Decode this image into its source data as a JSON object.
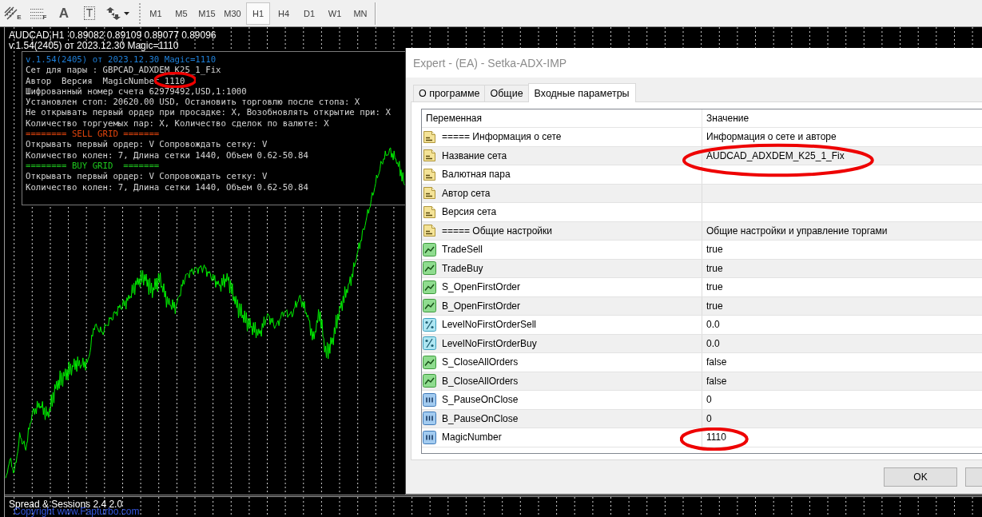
{
  "toolbar": {
    "tools": [
      {
        "kind": "channel",
        "glyph": "E",
        "dropdown": false
      },
      {
        "kind": "levels",
        "glyph": "F",
        "dropdown": false
      },
      {
        "kind": "text",
        "glyph": "A",
        "dropdown": false
      },
      {
        "kind": "label",
        "glyph": "T",
        "dropdown": false
      },
      {
        "kind": "arrows",
        "dropdown": true
      }
    ],
    "timeframes": [
      {
        "label": "M1",
        "selected": false
      },
      {
        "label": "M5",
        "selected": false
      },
      {
        "label": "M15",
        "selected": false
      },
      {
        "label": "M30",
        "selected": false
      },
      {
        "label": "H1",
        "selected": true
      },
      {
        "label": "H4",
        "selected": false
      },
      {
        "label": "D1",
        "selected": false
      },
      {
        "label": "W1",
        "selected": false
      },
      {
        "label": "MN",
        "selected": false
      }
    ]
  },
  "chart": {
    "header": [
      "AUDCAD,H1  0.89082 0.89109 0.89077 0.89096",
      "v.1.54(2405) от 2023.12.30 Magic=1110"
    ],
    "info_panel": {
      "lines": [
        {
          "text": "v.1.54(2405) от 2023.12.30 Magic=1110",
          "color": "#1e7fd8",
          "circled": false
        },
        {
          "text": "Сет для пары : GBPCAD_ADXDEM_K25_1_Fix",
          "color": "#d4d4d4",
          "circled": false
        },
        {
          "text": "Автор  Версия  MagicNumber",
          "value": "1110",
          "color": "#d4d4d4",
          "circled": true
        },
        {
          "text": "Шифрованный номер счета 62979492,USD,1:1000",
          "color": "#d4d4d4",
          "circled": false
        },
        {
          "text": "Установлен стоп: 20620.00 USD, Остановить торговлю после стопа: X",
          "color": "#d4d4d4",
          "circled": false
        },
        {
          "text": "Не открывать первый ордер при просадке: X, Возобновлять открытие при: X",
          "color": "#d4d4d4",
          "circled": false
        },
        {
          "text": "Количество торгуемых пар: X, Количество сделок по валюте: X",
          "color": "#d4d4d4",
          "circled": false
        },
        {
          "text": "======== SELL GRID =======",
          "color": "#e2440c",
          "circled": false
        },
        {
          "text": "Открывать первый ордер: V Сопровождать сетку: V",
          "color": "#d4d4d4",
          "circled": false
        },
        {
          "text": "Количество колен: 7, Длина сетки 1440, Объем 0.62-50.84",
          "color": "#d4d4d4",
          "circled": false
        },
        {
          "text": "======== BUY GRID  =======",
          "color": "#1ec81e",
          "circled": false
        },
        {
          "text": "Открывать первый ордер: V Сопровождать сетку: V",
          "color": "#d4d4d4",
          "circled": false
        },
        {
          "text": "Количество колен: 7, Длина сетки 1440, Объем 0.62-50.84",
          "color": "#d4d4d4",
          "circled": false
        }
      ]
    },
    "subwindow": {
      "lines": [
        {
          "text": "Spread & Sessions 2.4 2.0",
          "color": "#ffffff"
        },
        {
          "text": "Copyright www.Fapturbo.com",
          "color": "#3355dd"
        }
      ]
    }
  },
  "dialog": {
    "title": "Expert - (EA) - Setka-ADX-IMP",
    "tabs": [
      {
        "label": "О программе",
        "selected": false
      },
      {
        "label": "Общие",
        "selected": false
      },
      {
        "label": "Входные параметры",
        "selected": true
      }
    ],
    "params": {
      "columns": [
        "Переменная",
        "Значение"
      ],
      "rows": [
        {
          "kind": "string",
          "name": "===== Информация о сете",
          "value": "Информация о сете и авторе",
          "circled": false
        },
        {
          "kind": "string",
          "name": "Название сета",
          "value": "AUDCAD_ADXDEM_K25_1_Fix",
          "circled": true
        },
        {
          "kind": "string",
          "name": "Валютная пара",
          "circled": false
        },
        {
          "kind": "string",
          "name": "Автор сета",
          "circled": false
        },
        {
          "kind": "string",
          "name": "Версия сета",
          "circled": false
        },
        {
          "kind": "string",
          "name": "===== Общие настройки",
          "value": "Общие настройки и управление торгами",
          "circled": false
        },
        {
          "kind": "bool",
          "name": "TradeSell",
          "value": "true",
          "circled": false
        },
        {
          "kind": "bool",
          "name": "TradeBuy",
          "value": "true",
          "circled": false
        },
        {
          "kind": "bool",
          "name": "S_OpenFirstOrder",
          "value": "true",
          "circled": false
        },
        {
          "kind": "bool",
          "name": "B_OpenFirstOrder",
          "value": "true",
          "circled": false
        },
        {
          "kind": "double",
          "name": "LevelNoFirstOrderSell",
          "value": "0.0",
          "circled": false
        },
        {
          "kind": "double",
          "name": "LevelNoFirstOrderBuy",
          "value": "0.0",
          "circled": false
        },
        {
          "kind": "bool",
          "name": "S_CloseAllOrders",
          "value": "false",
          "circled": false
        },
        {
          "kind": "bool",
          "name": "B_CloseAllOrders",
          "value": "false",
          "circled": false
        },
        {
          "kind": "int",
          "name": "S_PauseOnClose",
          "value": "0",
          "circled": false
        },
        {
          "kind": "int",
          "name": "B_PauseOnClose",
          "value": "0",
          "circled": false
        },
        {
          "kind": "int",
          "name": "MagicNumber",
          "value": "1110",
          "circled": true
        }
      ]
    },
    "buttons": [
      "OK"
    ]
  }
}
